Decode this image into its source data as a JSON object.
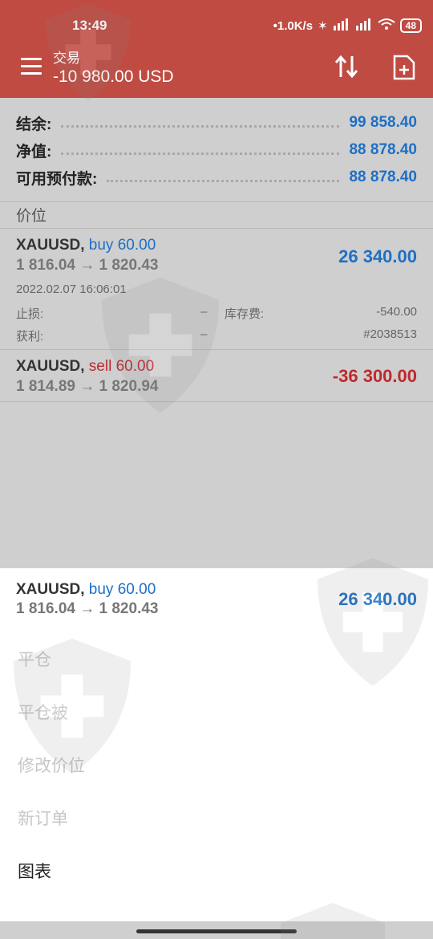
{
  "status": {
    "time": "13:49",
    "speed": "•1.0K/s",
    "battery": "48"
  },
  "header": {
    "title": "交易",
    "subtitle": "-10 980.00 USD",
    "accent": "#bf4b42"
  },
  "summary": [
    {
      "label": "结余:",
      "value": "99 858.40"
    },
    {
      "label": "净值:",
      "value": "88 878.40"
    },
    {
      "label": "可用预付款:",
      "value": "88 878.40"
    }
  ],
  "section": {
    "label": "价位"
  },
  "positions": [
    {
      "symbol": "XAUUSD,",
      "side": "buy 60.00",
      "prices": "1 816.04 → 1 820.43",
      "profit": "26 340.00",
      "time": "2022.02.07 16:06:01",
      "sl_label": "止损:",
      "sl_value": "–",
      "swap_label": "库存费:",
      "swap_value": "-540.00",
      "tp_label": "获利:",
      "tp_value": "–",
      "ticket": "#2038513"
    },
    {
      "symbol": "XAUUSD,",
      "side": "sell 60.00",
      "prices": "1 814.89 → 1 820.94",
      "profit": "-36 300.00"
    }
  ],
  "sheet": {
    "symbol": "XAUUSD,",
    "side": "buy 60.00",
    "prices": "1 816.04 → 1 820.43",
    "profit": "26 340.00",
    "menu": [
      "平仓",
      "平仓被",
      "修改价位",
      "新订单",
      "图表"
    ]
  },
  "colors": {
    "blue": "#1e6fc6",
    "red": "#c0282d"
  }
}
